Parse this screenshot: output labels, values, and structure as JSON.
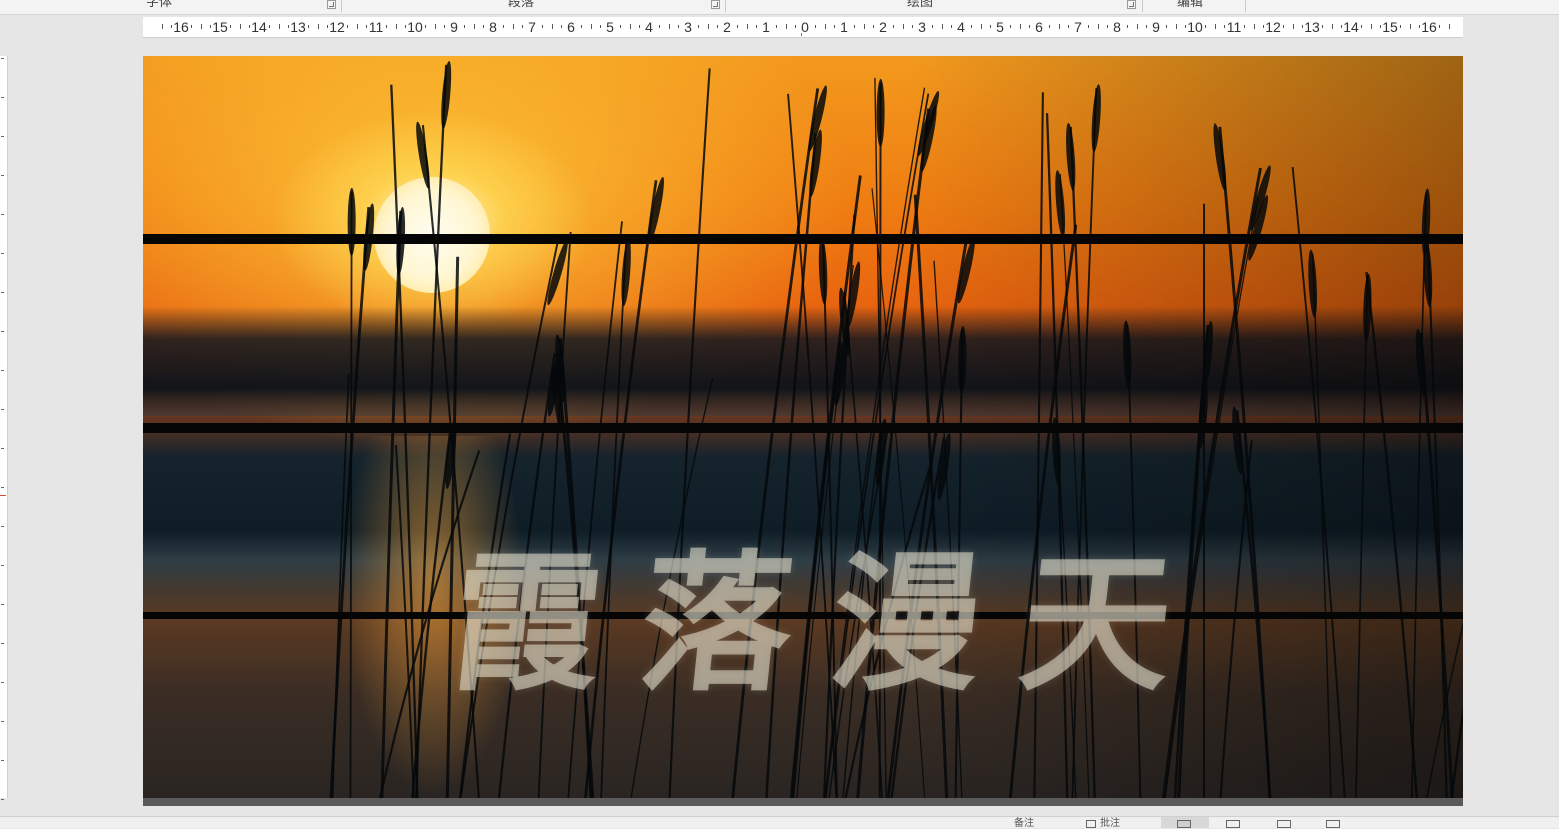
{
  "ribbon": {
    "groups": [
      {
        "label": "字体"
      },
      {
        "label": "段落"
      },
      {
        "label": "绘图"
      },
      {
        "label": "编辑"
      }
    ]
  },
  "ruler": {
    "labels": [
      "16",
      "15",
      "14",
      "13",
      "12",
      "11",
      "10",
      "9",
      "8",
      "7",
      "6",
      "5",
      "4",
      "3",
      "2",
      "1",
      "0",
      "1",
      "2",
      "3",
      "4",
      "5",
      "6",
      "7",
      "8",
      "9",
      "10",
      "11",
      "12",
      "13",
      "14",
      "15",
      "16"
    ]
  },
  "slide": {
    "title_chars": [
      "霞",
      "落",
      "漫",
      "天"
    ]
  },
  "colors": {
    "sky_top": "#f39a1e",
    "sky_mid": "#e8640f",
    "water": "#5b3a22",
    "band": "#050505",
    "canvas_bg": "#e6e6e6"
  },
  "status_bar": {
    "notes_label": "备注",
    "comments_label": "批注"
  }
}
